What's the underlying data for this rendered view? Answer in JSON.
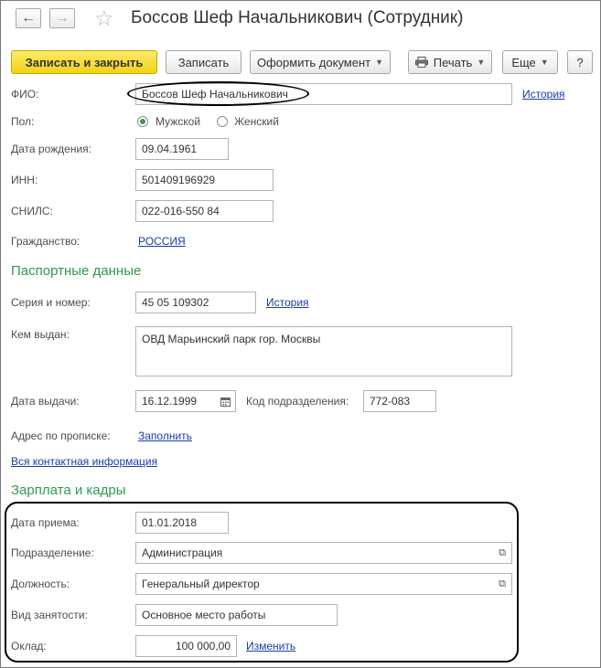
{
  "header": {
    "title": "Боссов Шеф Начальникович (Сотрудник)",
    "back_icon": "←",
    "forward_icon": "→",
    "favorite_icon": "☆"
  },
  "toolbar": {
    "save_close": "Записать и закрыть",
    "save": "Записать",
    "create_doc": "Оформить документ",
    "print": "Печать",
    "more": "Еще",
    "help": "?"
  },
  "person": {
    "fio_label": "ФИО:",
    "fio_value": "Боссов Шеф Начальникович",
    "history_link": "История",
    "gender_label": "Пол:",
    "gender_male": "Мужской",
    "gender_female": "Женский",
    "gender_selected": "Мужской",
    "birth_label": "Дата рождения:",
    "birth_value": "09.04.1961",
    "inn_label": "ИНН:",
    "inn_value": "501409196929",
    "snils_label": "СНИЛС:",
    "snils_value": "022-016-550 84",
    "citizenship_label": "Гражданство:",
    "citizenship_value": "РОССИЯ"
  },
  "passport": {
    "heading": "Паспортные данные",
    "series_label": "Серия и номер:",
    "series_value": "45 05 109302",
    "history_link": "История",
    "issuer_label": "Кем выдан:",
    "issuer_value": "ОВД Марьинский парк гор. Москвы",
    "issue_date_label": "Дата выдачи:",
    "issue_date_value": "16.12.1999",
    "dept_code_label": "Код подразделения:",
    "dept_code_value": "772-083",
    "address_label": "Адрес по прописке:",
    "address_link": "Заполнить",
    "contacts_link": "Вся контактная информация"
  },
  "hr": {
    "heading": "Зарплата и кадры",
    "hire_label": "Дата приема:",
    "hire_value": "01.01.2018",
    "dept_label": "Подразделение:",
    "dept_value": "Администрация",
    "position_label": "Должность:",
    "position_value": "Генеральный директор",
    "employment_label": "Вид занятости:",
    "employment_value": "Основное место работы",
    "salary_label": "Оклад:",
    "salary_value": "100 000,00",
    "salary_change_link": "Изменить"
  },
  "colors": {
    "accent_green": "#2e9a4e",
    "primary_button": "#f3d316",
    "link": "#1a3ba8"
  }
}
